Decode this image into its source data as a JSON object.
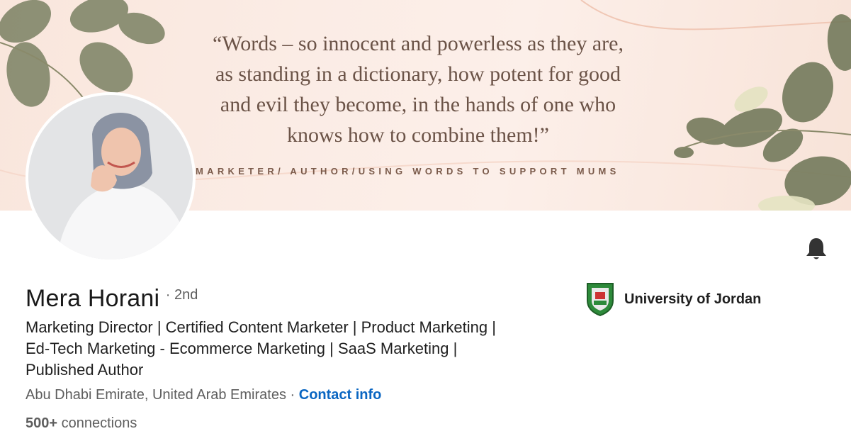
{
  "banner": {
    "quote_lines": [
      "“Words – so innocent and powerless as they are,",
      "as standing in a dictionary, how potent for good",
      "and evil they become, in the hands of one who",
      "knows how to combine them!”"
    ],
    "tagline": "MARKETER/ AUTHOR/USING WORDS TO SUPPORT MUMS"
  },
  "profile": {
    "name": "Mera Horani",
    "degree": "· 2nd",
    "headline_lines": [
      "Marketing Director | Certified Content Marketer | Product Marketing |",
      "Ed-Tech Marketing - Ecommerce Marketing | SaaS Marketing |",
      "Published Author"
    ],
    "location": "Abu Dhabi Emirate, United Arab Emirates",
    "separator": "·",
    "contact_label": "Contact info",
    "connections_count": "500+",
    "connections_label": "connections"
  },
  "school": {
    "name": "University of Jordan"
  },
  "icons": {
    "bell": "notification-bell-icon",
    "school_logo": "university-crest-icon"
  },
  "colors": {
    "link": "#0a66c2",
    "banner_text": "#6b5347",
    "leaf": "#7b8163"
  }
}
